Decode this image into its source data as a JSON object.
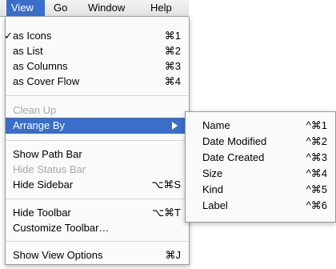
{
  "menubar": {
    "items": [
      {
        "label": "View"
      },
      {
        "label": "Go"
      },
      {
        "label": "Window"
      },
      {
        "label": "Help"
      }
    ]
  },
  "view_menu": {
    "as_icons": {
      "label": "as Icons",
      "shortcut": "⌘1",
      "checked": "✓"
    },
    "as_list": {
      "label": "as List",
      "shortcut": "⌘2"
    },
    "as_columns": {
      "label": "as Columns",
      "shortcut": "⌘3"
    },
    "as_cover_flow": {
      "label": "as Cover Flow",
      "shortcut": "⌘4"
    },
    "clean_up": {
      "label": "Clean Up"
    },
    "arrange_by": {
      "label": "Arrange By"
    },
    "show_path_bar": {
      "label": "Show Path Bar"
    },
    "hide_status_bar": {
      "label": "Hide Status Bar"
    },
    "hide_sidebar": {
      "label": "Hide Sidebar",
      "shortcut": "⌥⌘S"
    },
    "hide_toolbar": {
      "label": "Hide Toolbar",
      "shortcut": "⌥⌘T"
    },
    "customize_toolbar": {
      "label": "Customize Toolbar…"
    },
    "show_view_options": {
      "label": "Show View Options",
      "shortcut": "⌘J"
    }
  },
  "arrange_submenu": {
    "items": [
      {
        "label": "Name",
        "shortcut": "^⌘1"
      },
      {
        "label": "Date Modified",
        "shortcut": "^⌘2"
      },
      {
        "label": "Date Created",
        "shortcut": "^⌘3"
      },
      {
        "label": "Size",
        "shortcut": "^⌘4"
      },
      {
        "label": "Kind",
        "shortcut": "^⌘5"
      },
      {
        "label": "Label",
        "shortcut": "^⌘6"
      }
    ]
  },
  "colors": {
    "highlight": "#3a6ec8",
    "disabled": "#a8a8a8"
  }
}
